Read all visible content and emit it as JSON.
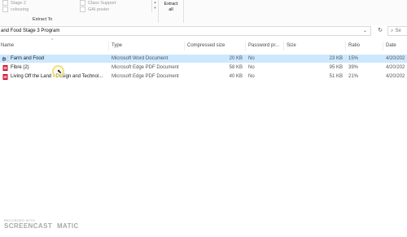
{
  "ribbon": {
    "col1": [
      "Stage 2",
      "colouring"
    ],
    "col2": [
      "Class Support",
      "GAI poster"
    ],
    "group_label": "Extract To",
    "extract_line1": "Extract",
    "extract_line2": "all"
  },
  "address": {
    "path": "and Food Stage 3 Program",
    "search_placeholder": "Se"
  },
  "columns": {
    "name": "Name",
    "type": "Type",
    "compressed_size": "Compressed size",
    "password": "Password pr...",
    "size": "Size",
    "ratio": "Ratio",
    "date": "Date"
  },
  "rows": [
    {
      "name": "Farm and Food",
      "type": "Microsoft Word Document",
      "compressed": "20 KB",
      "password": "No",
      "size": "23 KB",
      "ratio": "15%",
      "date": "4/20/202",
      "icon": "word-doc-icon",
      "icon_color": "#2b579a",
      "selected": true
    },
    {
      "name": "Fibre (2)",
      "type": "Microsoft Edge PDF Document",
      "compressed": "58 KB",
      "password": "No",
      "size": "95 KB",
      "ratio": "39%",
      "date": "4/20/202",
      "icon": "pdf-doc-icon",
      "icon_color": "#c8102e",
      "selected": false
    },
    {
      "name": "Living Off the Land - Design and Technol...",
      "type": "Microsoft Edge PDF Document",
      "compressed": "40 KB",
      "password": "No",
      "size": "51 KB",
      "ratio": "21%",
      "date": "4/20/202",
      "icon": "pdf-doc-icon",
      "icon_color": "#c8102e",
      "selected": false
    }
  ],
  "watermark": {
    "line1": "RECORDED WITH",
    "line2": "SCREENCAST",
    "line3": "MATIC"
  },
  "colors": {
    "selection": "#cce8ff",
    "word_blue": "#2b579a",
    "pdf_red": "#c8102e"
  }
}
